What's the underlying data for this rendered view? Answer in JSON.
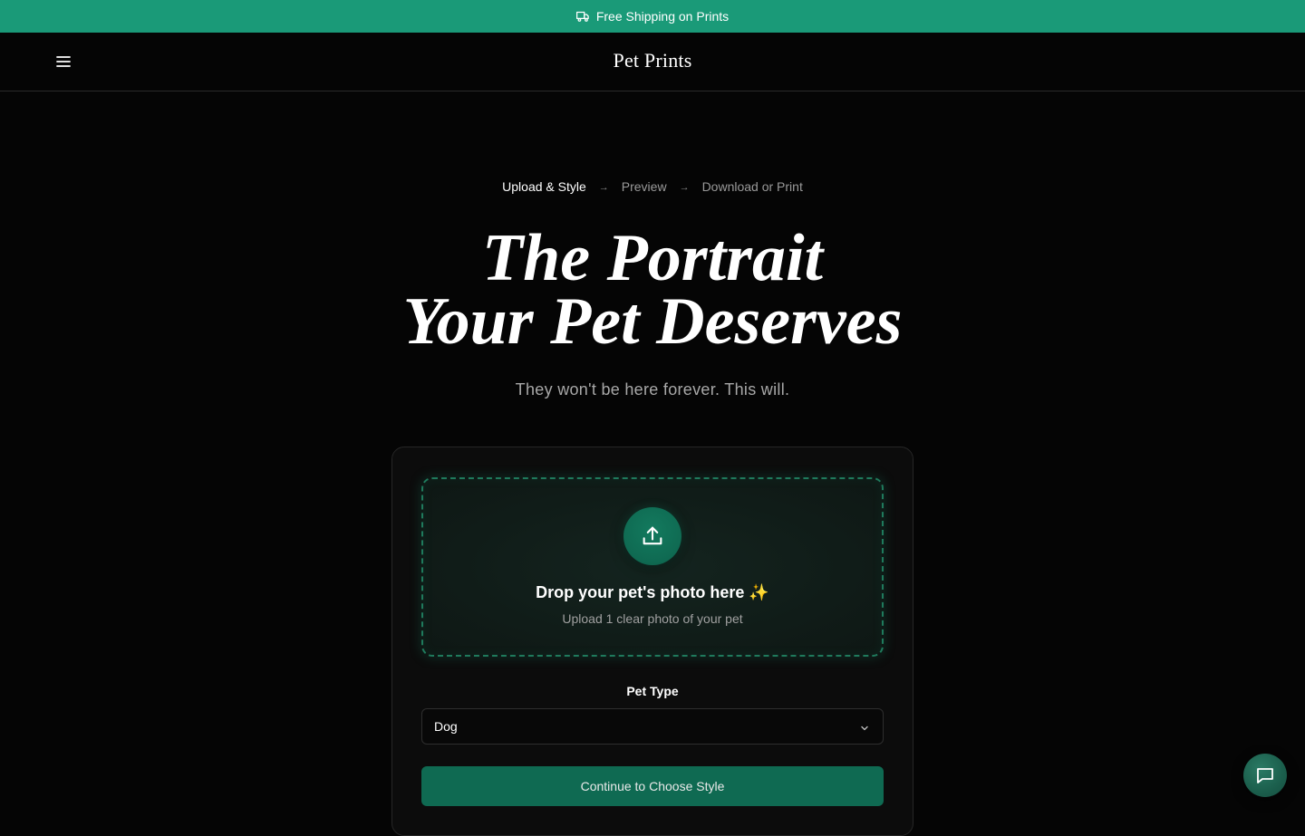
{
  "banner": {
    "text": "Free Shipping on Prints",
    "icon": "truck-icon",
    "color": "#1a9a78"
  },
  "header": {
    "brand": "Pet Prints",
    "menu_icon": "hamburger-menu-icon"
  },
  "steps": [
    {
      "label": "Upload & Style",
      "active": true
    },
    {
      "label": "Preview",
      "active": false
    },
    {
      "label": "Download or Print",
      "active": false
    }
  ],
  "step_separator": "→",
  "hero": {
    "title_line1": "The Portrait",
    "title_line2": "Your Pet Deserves",
    "subtitle": "They won't be here forever. This will."
  },
  "upload": {
    "icon": "upload-icon",
    "title": "Drop your pet's photo here ✨",
    "subtitle": "Upload 1 clear photo of your pet"
  },
  "pet_type": {
    "label": "Pet Type",
    "selected": "Dog",
    "icon": "chevron-down-icon"
  },
  "continue_button": {
    "label": "Continue to Choose Style",
    "color": "#0f6a52"
  },
  "chat": {
    "icon": "chat-bubble-icon"
  }
}
